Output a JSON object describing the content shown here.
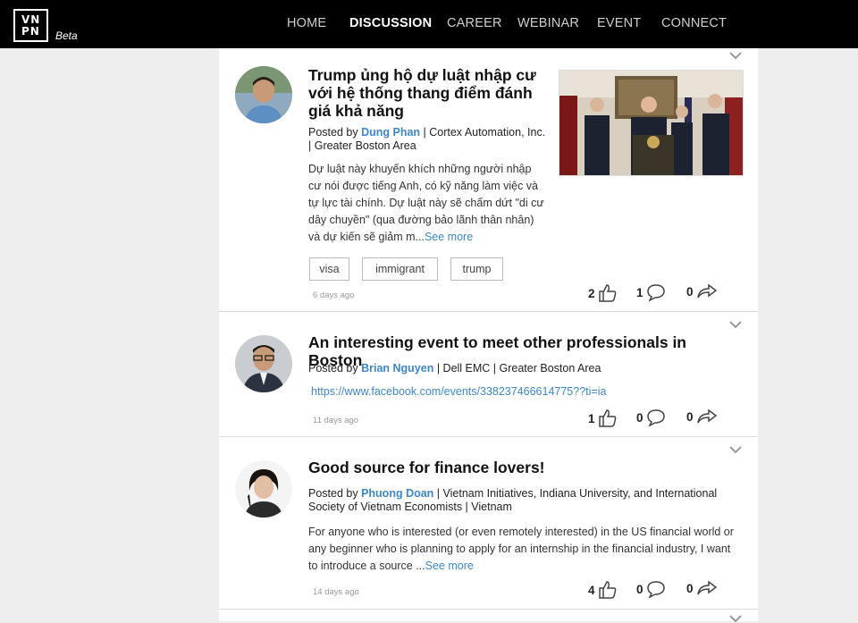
{
  "brand": {
    "logo_line1": "VN",
    "logo_line2": "PN",
    "badge": "Beta"
  },
  "nav": {
    "items": [
      {
        "label": "HOME",
        "active": false
      },
      {
        "label": "DISCUSSION",
        "active": true
      },
      {
        "label": "CAREER",
        "active": false
      },
      {
        "label": "WEBINAR",
        "active": false
      },
      {
        "label": "EVENT",
        "active": false
      },
      {
        "label": "CONNECT",
        "active": false
      }
    ]
  },
  "posts": [
    {
      "title": "Trump ủng hộ dự luật nhập cư với hệ thống thang điểm đánh giá khả năng",
      "posted_by": "Posted by",
      "author": "Dung Phan",
      "affiliation": " | Cortex Automation, Inc. | Greater Boston Area",
      "excerpt": "Dự luật này khuyến khích những người nhập cư nói được tiếng Anh, có kỹ năng làm việc và tự lực tài chính. Dự luật này sẽ chấm dứt \"di cư dây chuyền\" (qua đường bảo lãnh thân nhân) và dự kiến sẽ giảm m...",
      "see_more": "See more",
      "tags": [
        "visa",
        "immigrant",
        "trump"
      ],
      "time": "6 days ago",
      "likes": "2",
      "comments": "1",
      "shares": "0"
    },
    {
      "title": "An interesting event to meet other professionals in Boston",
      "posted_by": "Posted by",
      "author": "Brian Nguyen",
      "affiliation": " | Dell EMC | Greater Boston Area",
      "link": "https://www.facebook.com/events/338237466614775??ti=ia",
      "time": "11 days ago",
      "likes": "1",
      "comments": "0",
      "shares": "0"
    },
    {
      "title": "Good source for finance lovers!",
      "posted_by": "Posted by",
      "author": "Phuong Doan",
      "affiliation": " | Vietnam Initiatives, Indiana University, and International Society of Vietnam Economists | Vietnam",
      "excerpt": "For anyone who is interested (or even remotely interested) in the US financial world or any beginner who is planning to apply for an internship in the financial industry, I want to introduce a source ...",
      "see_more": "See more",
      "time": "14 days ago",
      "likes": "4",
      "comments": "0",
      "shares": "0"
    }
  ],
  "colors": {
    "nav_bg": "#000000",
    "link": "#3f86c8",
    "page_bg": "#eeeeee"
  },
  "icons": [
    "chevron-down-icon",
    "thumbs-up-icon",
    "comment-icon",
    "share-icon"
  ]
}
